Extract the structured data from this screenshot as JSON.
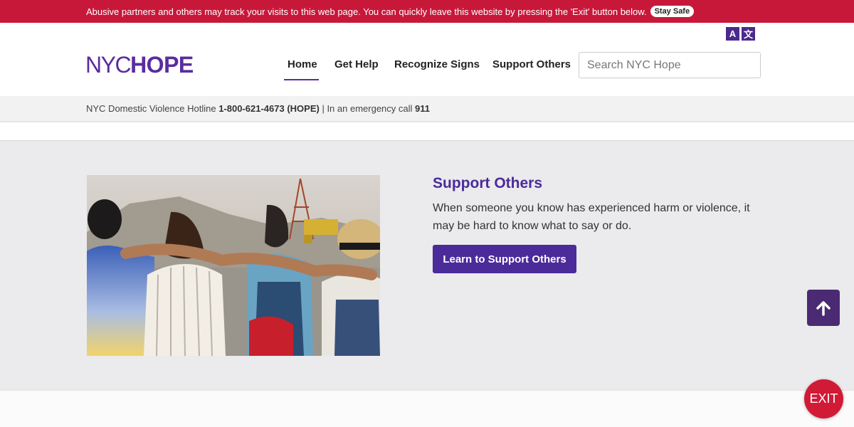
{
  "alert": {
    "text": "Abusive partners and others may track your visits to this web page. You can quickly leave this website by pressing the 'Exit' button below.",
    "stay_safe": "Stay Safe"
  },
  "translate": {
    "glyph_a": "A",
    "glyph_b": "文"
  },
  "logo": {
    "nyc": "NYC",
    "hope": "HOPE"
  },
  "nav": {
    "items": [
      "Home",
      "Get Help",
      "Recognize Signs",
      "Support Others"
    ],
    "active": "Home"
  },
  "search": {
    "placeholder": "Search NYC Hope"
  },
  "hotline": {
    "prefix": "NYC Domestic Violence Hotline",
    "number": "1-800-621-4673 (HOPE)",
    "separator": "| In an emergency call",
    "emergency": "911"
  },
  "feature": {
    "title": "Support Others",
    "text": "When someone you know has experienced harm or violence, it may be hard to know what to say or do.",
    "button": "Learn to Support Others",
    "image_icon": "photo-of-friends-arm-in-arm"
  },
  "back_to_top": {
    "icon": "arrow-up-icon"
  },
  "exit": {
    "label": "EXIT"
  },
  "colors": {
    "alert": "#c8183a",
    "brand": "#4b2a9a",
    "exit": "#d11a36",
    "back_to_top": "#4a2a73"
  }
}
